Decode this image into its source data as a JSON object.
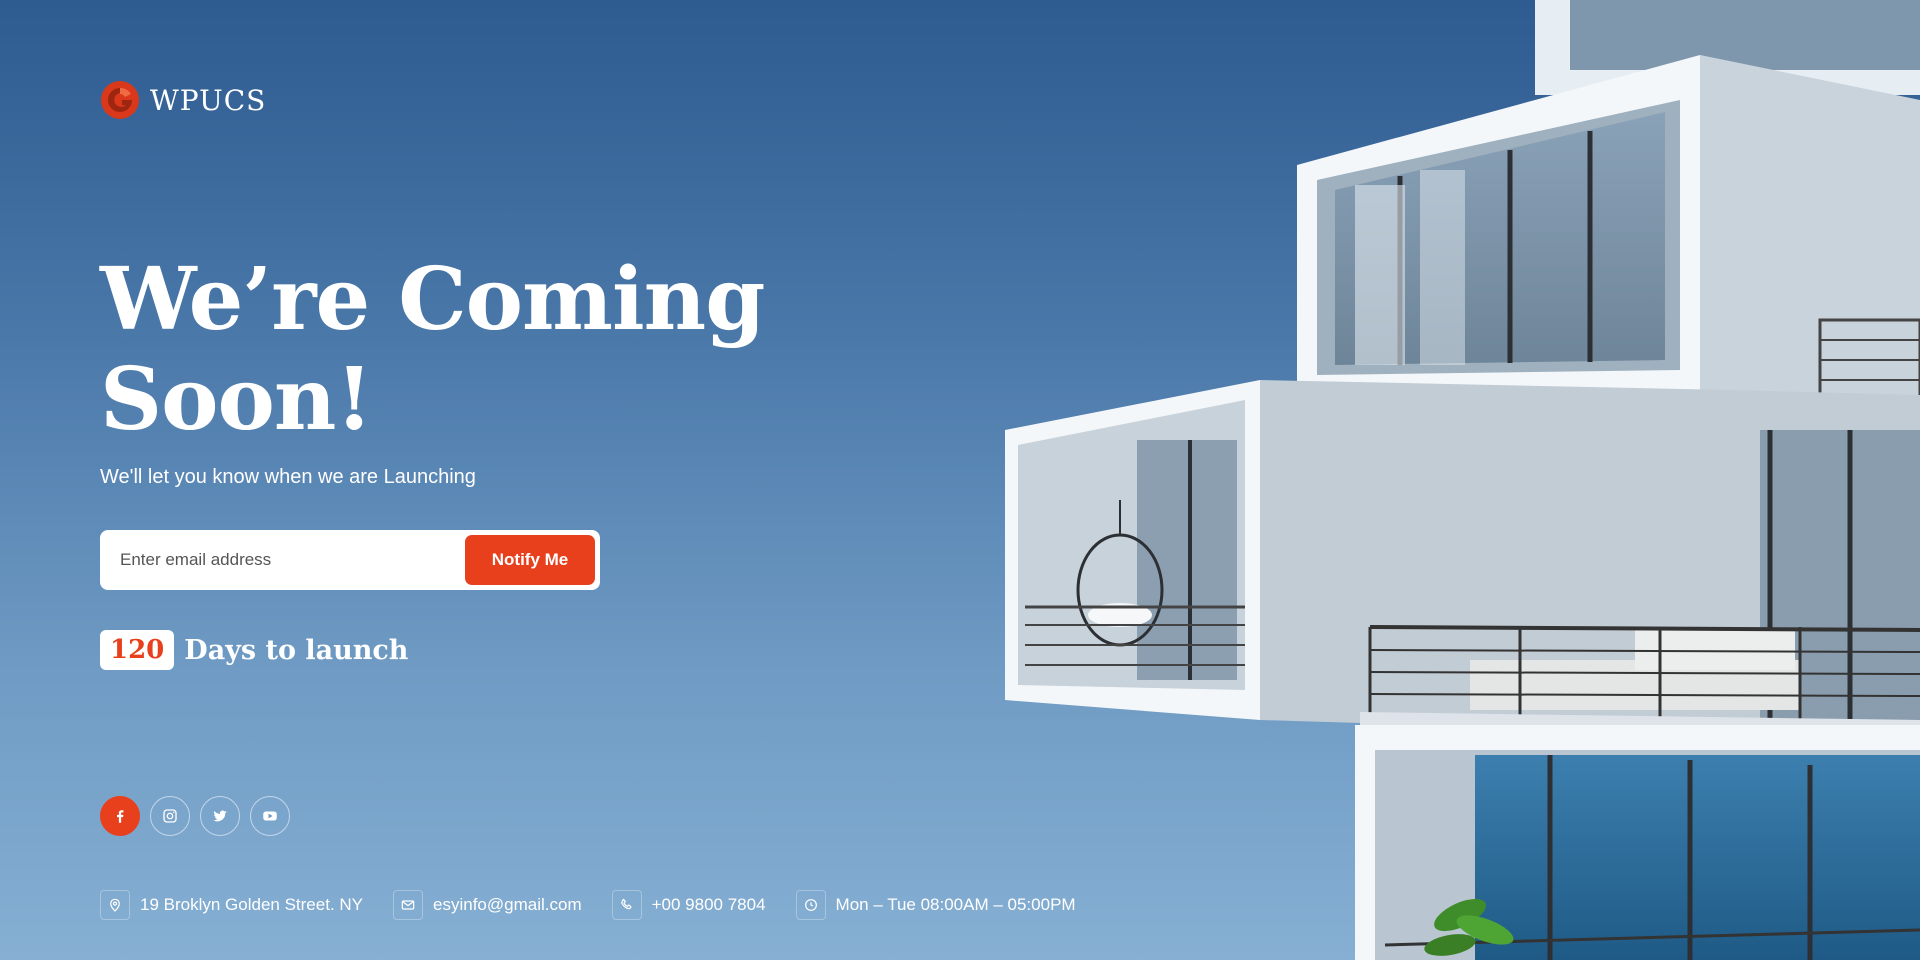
{
  "brand": {
    "name": "WPUCS"
  },
  "hero": {
    "title": "We’re Coming Soon!",
    "subtitle": "We'll let you know when we are Launching"
  },
  "subscribe": {
    "placeholder": "Enter email address",
    "value": "",
    "button_label": "Notify Me"
  },
  "countdown": {
    "days": "120",
    "label": "Days to launch"
  },
  "socials": [
    {
      "icon": "facebook-icon",
      "active": true
    },
    {
      "icon": "instagram-icon",
      "active": false
    },
    {
      "icon": "twitter-icon",
      "active": false
    },
    {
      "icon": "youtube-icon",
      "active": false
    }
  ],
  "contacts": {
    "address": {
      "icon": "location-pin-icon",
      "text": "19 Broklyn Golden Street. NY"
    },
    "email": {
      "icon": "mail-icon",
      "text": "esyinfo@gmail.com"
    },
    "phone": {
      "icon": "phone-icon",
      "text": "+00 9800 7804"
    },
    "hours": {
      "icon": "clock-icon",
      "text": "Mon – Tue 08:00AM – 05:00PM"
    }
  },
  "colors": {
    "accent": "#e8401c",
    "background_top": "#2e5b90",
    "background_bottom": "#86afd3"
  }
}
